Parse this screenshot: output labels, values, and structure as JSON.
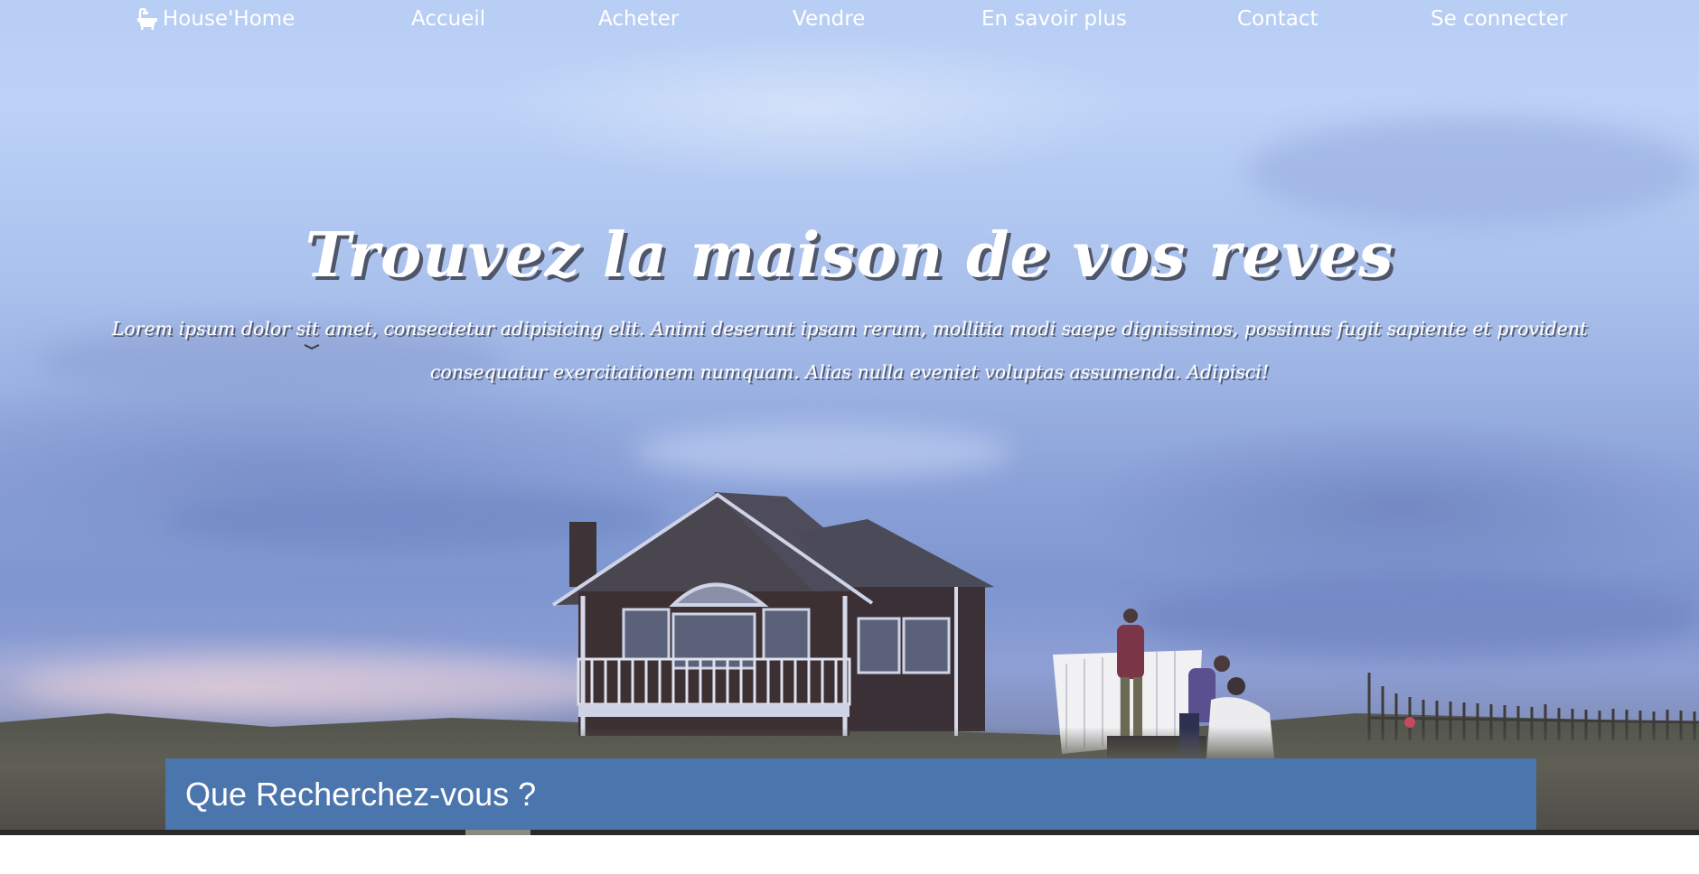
{
  "brand": {
    "icon": "bath-icon",
    "name": "House'Home"
  },
  "nav": {
    "items": [
      {
        "label": "Accueil"
      },
      {
        "label": "Acheter"
      },
      {
        "label": "Vendre"
      },
      {
        "label": "En savoir plus"
      },
      {
        "label": "Contact"
      },
      {
        "label": "Se connecter"
      }
    ]
  },
  "hero": {
    "title": "Trouvez la maison de vos reves",
    "subtitle": "Lorem ipsum dolor sit amet, consectetur adipisicing elit. Animi deserunt ipsam rerum, mollitia modi saepe dignissimos, possimus fugit sapiente et provident consequatur exercitationem numquam. Alias nulla eveniet voluptas assumenda. Adipisci!"
  },
  "search": {
    "title": "Que Recherchez-vous ?"
  },
  "colors": {
    "search_panel": "#4b75ad",
    "text": "#ffffff"
  }
}
